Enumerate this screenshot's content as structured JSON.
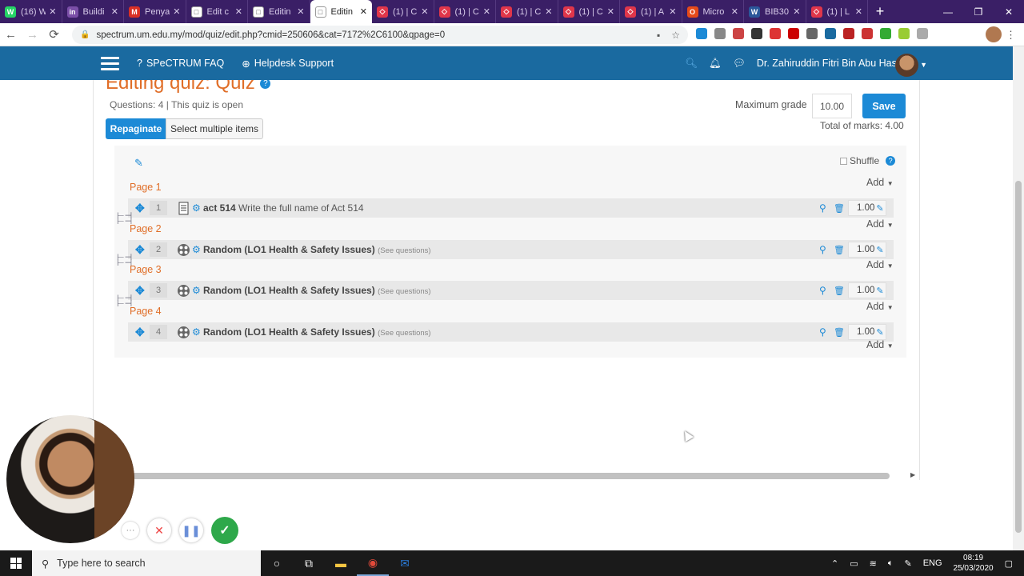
{
  "browser": {
    "tabs": [
      {
        "label": "(16) W",
        "color": "#25d366",
        "glyph": "W"
      },
      {
        "label": "Buildi",
        "color": "#7b4fa8",
        "glyph": "in"
      },
      {
        "label": "Penya",
        "color": "#d93025",
        "glyph": "M"
      },
      {
        "label": "Edit c",
        "color": "#ffffff",
        "glyph": "□"
      },
      {
        "label": "Editin",
        "color": "#ffffff",
        "glyph": "□"
      },
      {
        "label": "Editin",
        "color": "#ffffff",
        "glyph": "□",
        "active": true
      },
      {
        "label": "(1) | C",
        "color": "#e0364a",
        "glyph": "◇"
      },
      {
        "label": "(1) | C",
        "color": "#e0364a",
        "glyph": "◇"
      },
      {
        "label": "(1) | C",
        "color": "#e0364a",
        "glyph": "◇"
      },
      {
        "label": "(1) | C",
        "color": "#e0364a",
        "glyph": "◇"
      },
      {
        "label": "(1) | A",
        "color": "#e0364a",
        "glyph": "◇"
      },
      {
        "label": "Micro",
        "color": "#e64a19",
        "glyph": "O"
      },
      {
        "label": "BIB30",
        "color": "#2b579a",
        "glyph": "W"
      },
      {
        "label": "(1) | L",
        "color": "#e0364a",
        "glyph": "◇"
      }
    ],
    "url": "spectrum.um.edu.my/mod/quiz/edit.php?cmid=250606&cat=7172%2C6100&qpage=0"
  },
  "moodle_nav": {
    "faq": "SPeCTRUM FAQ",
    "helpdesk": "Helpdesk Support",
    "user_name": "Dr. Zahiruddin Fitri Bin Abu Hassan ."
  },
  "quiz": {
    "title": "Editing quiz: Quiz",
    "questions_status": "Questions: 4  |  This quiz is open",
    "repaginate": "Repaginate",
    "select_multiple": "Select multiple items",
    "max_grade_label": "Maximum grade",
    "max_grade_value": "10.00",
    "save": "Save",
    "total_marks": "Total of marks: 4.00",
    "shuffle_label": "Shuffle",
    "add_label": "Add",
    "pages": [
      {
        "label": "Page 1",
        "q": {
          "num": "1",
          "type": "essay",
          "name": "act 514",
          "text": "Write the full name of Act 514",
          "see": "",
          "mark": "1.00"
        }
      },
      {
        "label": "Page 2",
        "q": {
          "num": "2",
          "type": "random",
          "name": "Random (LO1 Health & Safety Issues)",
          "text": "",
          "see": "(See questions)",
          "mark": "1.00"
        }
      },
      {
        "label": "Page 3",
        "q": {
          "num": "3",
          "type": "random",
          "name": "Random (LO1 Health & Safety Issues)",
          "text": "",
          "see": "(See questions)",
          "mark": "1.00"
        }
      },
      {
        "label": "Page 4",
        "q": {
          "num": "4",
          "type": "random",
          "name": "Random (LO1 Health & Safety Issues)",
          "text": "",
          "see": "(See questions)",
          "mark": "1.00"
        }
      }
    ]
  },
  "taskbar": {
    "search_placeholder": "Type here to search",
    "lang": "ENG",
    "time": "08:19",
    "date": "25/03/2020"
  }
}
